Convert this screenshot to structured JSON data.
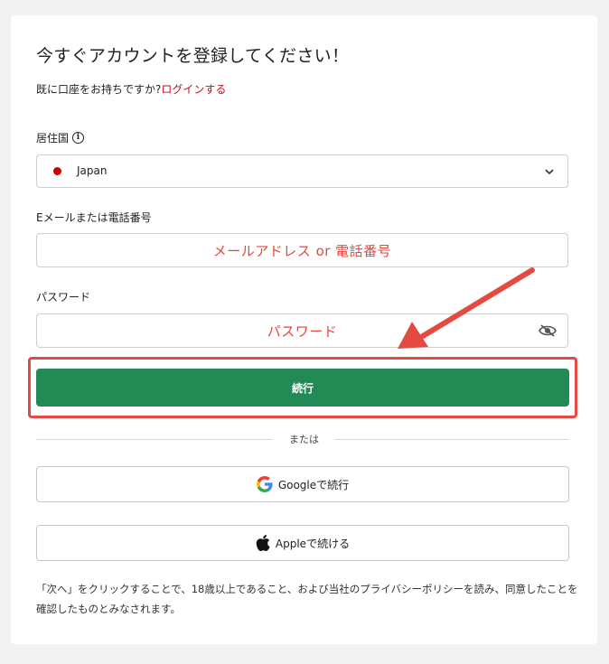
{
  "signup": {
    "title": "今すぐアカウントを登録してください！",
    "login_prompt": "既に口座をお持ちですか?",
    "login_link": "ログインする"
  },
  "residence": {
    "label": "居住国",
    "info_icon": "info-circle-icon",
    "selected": "Japan",
    "flag_color": "#cc0000",
    "chevron_icon": "chevron-down-icon"
  },
  "email": {
    "label": "Eメールまたは電話番号",
    "annotation": "メールアドレス or 電話番号"
  },
  "password": {
    "label": "パスワード",
    "annotation": "パスワード",
    "toggle_icon": "eye-slash-icon"
  },
  "continue_button": {
    "label": "続行",
    "color": "#218a55"
  },
  "divider": {
    "text": "または"
  },
  "social": {
    "google_label": "Googleで続行",
    "google_icon": "google-icon",
    "apple_label": "Appleで続ける",
    "apple_icon": "apple-icon"
  },
  "disclaimer": "「次へ」をクリックすることで、18歳以上であること、および当社のプライバシーポリシーを読み、同意したことを確認したものとみなされます。",
  "annotations": {
    "accent_color": "#e5473b",
    "arrow_icon": "red-arrow-annotation"
  }
}
